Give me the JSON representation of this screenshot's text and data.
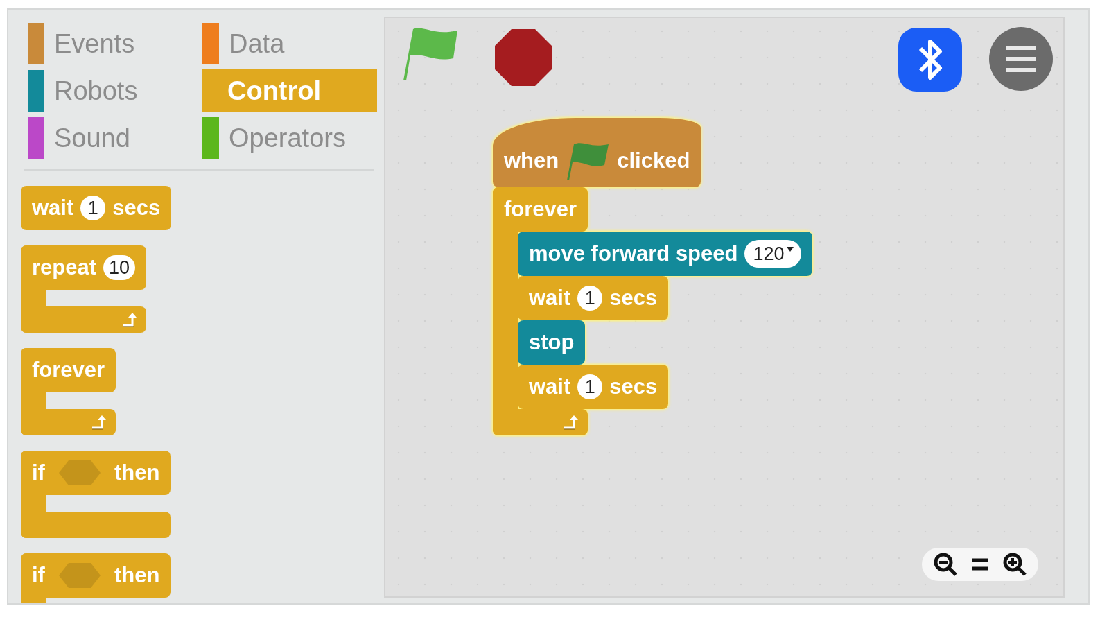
{
  "categories": [
    {
      "label": "Events",
      "color": "#c98a3a",
      "selected": false
    },
    {
      "label": "Data",
      "color": "#ee7d1e",
      "selected": false
    },
    {
      "label": "Robots",
      "color": "#138a9a",
      "selected": false
    },
    {
      "label": "Control",
      "color": "#e0a91f",
      "selected": true
    },
    {
      "label": "Sound",
      "color": "#bb48c8",
      "selected": false
    },
    {
      "label": "Operators",
      "color": "#5cb71c",
      "selected": false
    }
  ],
  "palette_blocks": [
    {
      "kind": "command",
      "color": "#e0a91f",
      "parts": [
        {
          "kind": "label",
          "text": "wait"
        },
        {
          "kind": "number",
          "text": "1"
        },
        {
          "kind": "label",
          "text": "secs"
        }
      ]
    },
    {
      "kind": "loop",
      "color": "#e0a91f",
      "parts": [
        {
          "kind": "label",
          "text": "repeat"
        },
        {
          "kind": "number",
          "text": "10"
        }
      ]
    },
    {
      "kind": "loop",
      "color": "#e0a91f",
      "parts": [
        {
          "kind": "label",
          "text": "forever"
        }
      ]
    },
    {
      "kind": "if",
      "color": "#e0a91f",
      "parts": [
        {
          "kind": "label",
          "text": "if"
        },
        {
          "kind": "boolean"
        },
        {
          "kind": "label",
          "text": "then"
        }
      ]
    },
    {
      "kind": "if",
      "color": "#e0a91f",
      "parts": [
        {
          "kind": "label",
          "text": "if"
        },
        {
          "kind": "boolean"
        },
        {
          "kind": "label",
          "text": "then"
        }
      ]
    }
  ],
  "script": {
    "running": true,
    "blocks": [
      {
        "kind": "hat",
        "color": "#c98a3a",
        "parts": [
          {
            "kind": "label",
            "text": "when"
          },
          {
            "kind": "flag"
          },
          {
            "kind": "label",
            "text": "clicked"
          }
        ]
      },
      {
        "kind": "loop",
        "color": "#e0a91f",
        "parts": [
          {
            "kind": "label",
            "text": "forever"
          }
        ],
        "children": [
          {
            "kind": "command",
            "color": "#138a9a",
            "parts": [
              {
                "kind": "label",
                "text": "move forward speed"
              },
              {
                "kind": "dropdown",
                "text": "120"
              }
            ]
          },
          {
            "kind": "command",
            "color": "#e0a91f",
            "parts": [
              {
                "kind": "label",
                "text": "wait"
              },
              {
                "kind": "number",
                "text": "1"
              },
              {
                "kind": "label",
                "text": "secs"
              }
            ]
          },
          {
            "kind": "command",
            "color": "#138a9a",
            "parts": [
              {
                "kind": "label",
                "text": "stop"
              }
            ]
          },
          {
            "kind": "command",
            "color": "#e0a91f",
            "parts": [
              {
                "kind": "label",
                "text": "wait"
              },
              {
                "kind": "number",
                "text": "1"
              },
              {
                "kind": "label",
                "text": "secs"
              }
            ]
          }
        ]
      }
    ]
  }
}
